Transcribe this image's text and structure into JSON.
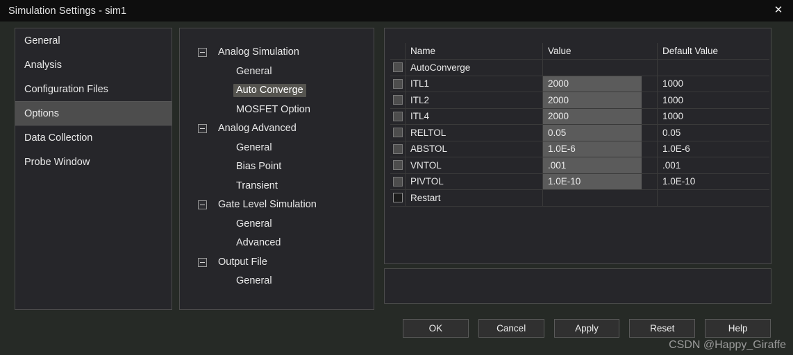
{
  "window": {
    "title": "Simulation Settings - sim1",
    "close_icon": "close-icon",
    "close_glyph": "✕"
  },
  "sidebar": {
    "items": [
      {
        "label": "General",
        "selected": false
      },
      {
        "label": "Analysis",
        "selected": false
      },
      {
        "label": "Configuration Files",
        "selected": false
      },
      {
        "label": "Options",
        "selected": true
      },
      {
        "label": "Data Collection",
        "selected": false
      },
      {
        "label": "Probe Window",
        "selected": false
      }
    ]
  },
  "tree": {
    "nodes": [
      {
        "label": "Analog Simulation",
        "type": "group",
        "expander": "minus-box-icon",
        "selected": false
      },
      {
        "label": "General",
        "type": "child",
        "selected": false
      },
      {
        "label": "Auto Converge",
        "type": "child",
        "selected": true
      },
      {
        "label": "MOSFET Option",
        "type": "child",
        "selected": false
      },
      {
        "label": "Analog Advanced",
        "type": "group",
        "expander": "minus-box-icon",
        "selected": false
      },
      {
        "label": "General",
        "type": "child",
        "selected": false
      },
      {
        "label": "Bias Point",
        "type": "child",
        "selected": false
      },
      {
        "label": "Transient",
        "type": "child",
        "selected": false
      },
      {
        "label": "Gate Level Simulation",
        "type": "group",
        "expander": "minus-box-icon",
        "selected": false
      },
      {
        "label": "General",
        "type": "child",
        "selected": false
      },
      {
        "label": "Advanced",
        "type": "child",
        "selected": false
      },
      {
        "label": "Output File",
        "type": "group",
        "expander": "minus-box-icon",
        "selected": false
      },
      {
        "label": "General",
        "type": "child",
        "selected": false
      }
    ]
  },
  "table": {
    "columns": [
      "Name",
      "Value",
      "Default Value"
    ],
    "rows": [
      {
        "checked": true,
        "name": "AutoConverge",
        "value": "",
        "default": ""
      },
      {
        "checked": true,
        "name": "ITL1",
        "value": "2000",
        "default": "1000"
      },
      {
        "checked": true,
        "name": "ITL2",
        "value": "2000",
        "default": "1000"
      },
      {
        "checked": true,
        "name": "ITL4",
        "value": "2000",
        "default": "1000"
      },
      {
        "checked": true,
        "name": "RELTOL",
        "value": "0.05",
        "default": "0.05"
      },
      {
        "checked": true,
        "name": "ABSTOL",
        "value": "1.0E-6",
        "default": "1.0E-6"
      },
      {
        "checked": true,
        "name": "VNTOL",
        "value": ".001",
        "default": ".001"
      },
      {
        "checked": true,
        "name": "PIVTOL",
        "value": "1.0E-10",
        "default": "1.0E-10"
      },
      {
        "checked": false,
        "name": "Restart",
        "value": "",
        "default": ""
      }
    ]
  },
  "description": {
    "text": ""
  },
  "buttons": [
    {
      "label": "OK"
    },
    {
      "label": "Cancel"
    },
    {
      "label": "Apply"
    },
    {
      "label": "Reset"
    },
    {
      "label": "Help"
    }
  ],
  "watermark": {
    "text": "CSDN @Happy_Giraffe"
  },
  "colors": {
    "window_background": "#262a26",
    "titlebar": "#0e0e0e",
    "panel_background": "#26262a",
    "panel_border": "#4c4c4c",
    "selection_sidebar": "#4d4d4d",
    "selection_tree": "#55544f",
    "value_cell_highlight": "#5b5b5b",
    "text": "#e9e9e9"
  }
}
